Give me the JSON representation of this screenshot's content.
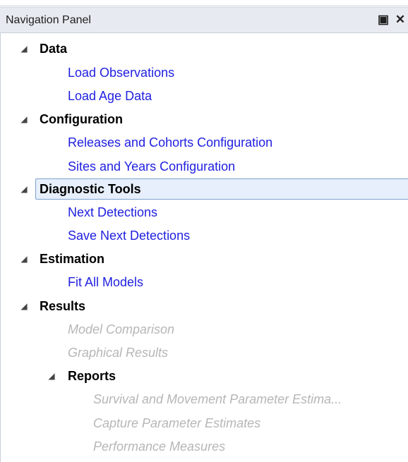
{
  "header": {
    "title": "Navigation Panel",
    "restore_glyph": "▣",
    "close_glyph": "✕",
    "restore_icon": "restore-window-icon",
    "close_icon": "close-icon"
  },
  "tree": {
    "expander_glyph": "◢",
    "groups": {
      "data": {
        "label": "Data",
        "items": [
          "Load Observations",
          "Load Age Data"
        ]
      },
      "configuration": {
        "label": "Configuration",
        "items": [
          "Releases and Cohorts Configuration",
          "Sites and Years Configuration"
        ]
      },
      "diagnostic_tools": {
        "label": "Diagnostic Tools",
        "selected": true,
        "items": [
          "Next Detections",
          "Save Next Detections"
        ]
      },
      "estimation": {
        "label": "Estimation",
        "items": [
          "Fit All Models"
        ]
      },
      "results": {
        "label": "Results",
        "items": [
          "Model Comparison",
          "Graphical Results"
        ],
        "subgroup": {
          "label": "Reports",
          "items": [
            "Survival and Movement Parameter Estima...",
            "Capture Parameter Estimates",
            "Performance Measures"
          ]
        }
      }
    }
  }
}
